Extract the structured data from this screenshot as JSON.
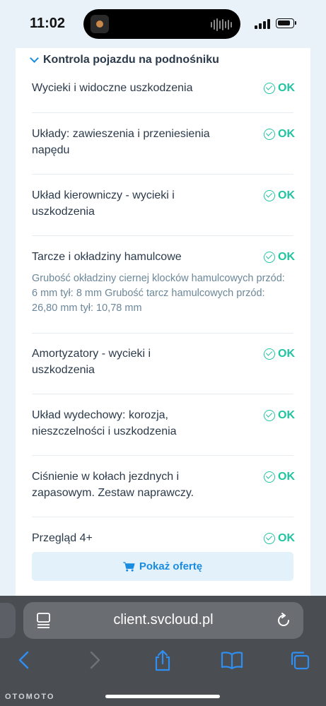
{
  "status_bar": {
    "time": "11:02"
  },
  "section": {
    "title": "Kontrola pojazdu na podnośniku"
  },
  "items": [
    {
      "label": "Wycieki i widoczne uszkodzenia",
      "status": "OK"
    },
    {
      "label": "Układy: zawieszenia i przeniesienia napędu",
      "status": "OK"
    },
    {
      "label": "Układ kierowniczy - wycieki i uszkodzenia",
      "status": "OK"
    },
    {
      "label": "Tarcze i okładziny hamulcowe",
      "status": "OK",
      "note": "Grubość okładziny ciernej klocków hamulcowych przód: 6 mm tył: 8 mm Grubość tarcz hamulcowych przód: 26,80 mm tył: 10,78 mm"
    },
    {
      "label": "Amortyzatory - wycieki i uszkodzenia",
      "status": "OK"
    },
    {
      "label": "Układ wydechowy: korozja, nieszczelności i uszkodzenia",
      "status": "OK"
    },
    {
      "label": "Ciśnienie w kołach jezdnych i zapasowym. Zestaw naprawczy.",
      "status": "OK"
    },
    {
      "label": "Przegląd 4+",
      "status": "OK"
    }
  ],
  "offer_button": {
    "label": "Pokaż ofertę"
  },
  "browser": {
    "url": "client.svcloud.pl",
    "watermark": "OTOMOTO"
  },
  "colors": {
    "accent": "#1a8ce0",
    "ok": "#1fc4a0",
    "text": "#2b3a4a",
    "note": "#6b8799"
  }
}
